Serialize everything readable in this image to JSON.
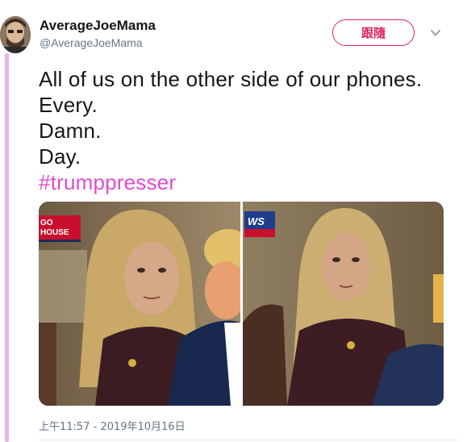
{
  "user": {
    "display_name": "AverageJoeMama",
    "handle": "@AverageJoeMama",
    "follow_label": "跟隨"
  },
  "tweet": {
    "lines": [
      "All of us on the other side of our phones.",
      "Every.",
      "Damn.",
      "Day."
    ],
    "hashtag": "#trumppresser",
    "timestamp": "上午11:57 - 2019年10月16日"
  },
  "media": {
    "left_overlay_lines": [
      "GO",
      "HOUSE"
    ],
    "right_overlay_text": "WS"
  },
  "colors": {
    "follow_accent": "#e0245e",
    "hashtag": "#e04bd0",
    "thread_line": "#e8b4ea",
    "secondary_text": "#657786"
  },
  "icons": {
    "caret": "chevron-down-icon"
  }
}
